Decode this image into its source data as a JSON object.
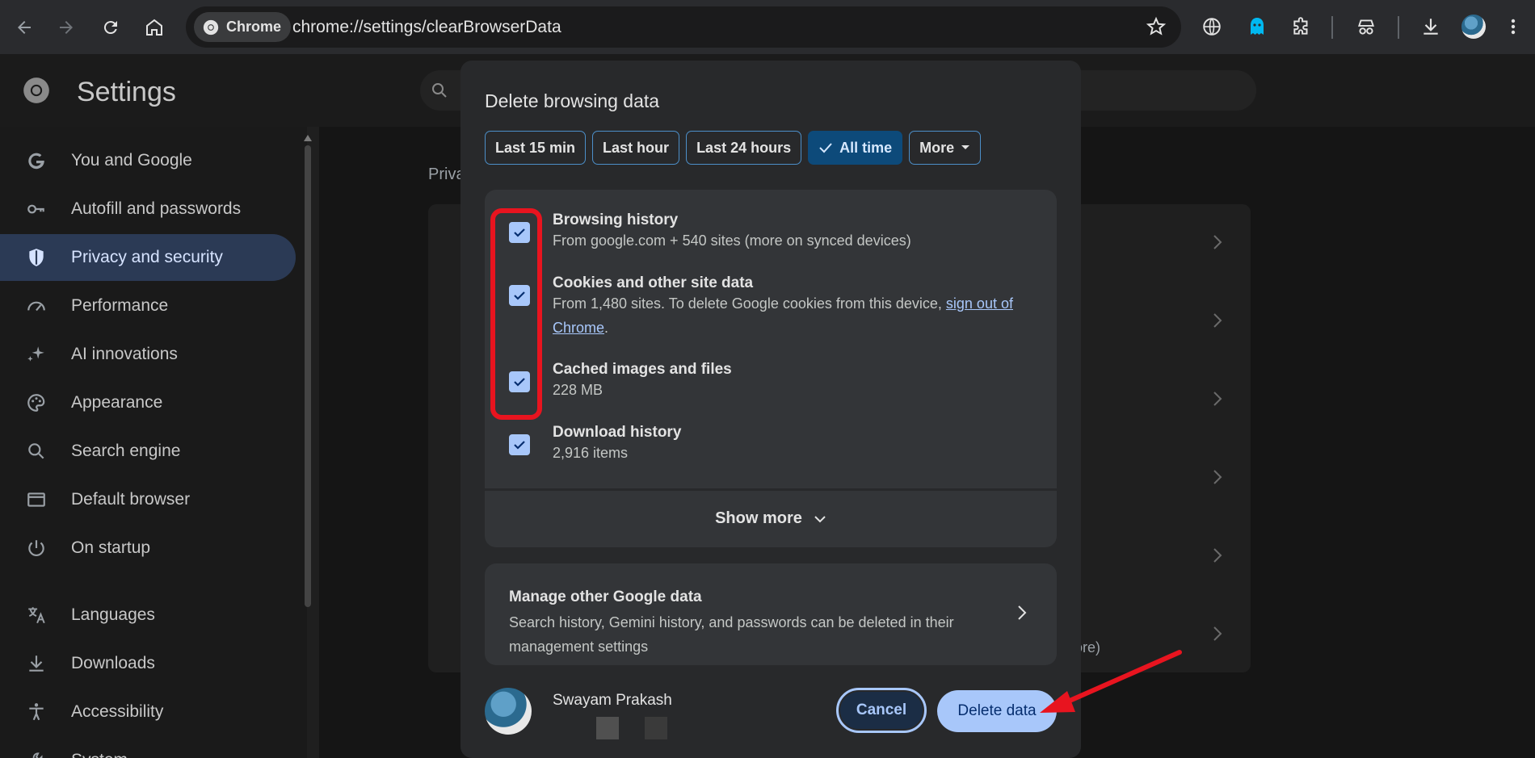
{
  "browser": {
    "chip_label": "Chrome",
    "url": "chrome://settings/clearBrowserData"
  },
  "settings": {
    "title": "Settings",
    "section_label": "Priva",
    "row_tail_text": "ore)",
    "sidebar": [
      {
        "label": "You and Google",
        "icon": "google-g-icon"
      },
      {
        "label": "Autofill and passwords",
        "icon": "key-icon"
      },
      {
        "label": "Privacy and security",
        "icon": "shield-icon",
        "active": true
      },
      {
        "label": "Performance",
        "icon": "speedometer-icon"
      },
      {
        "label": "AI innovations",
        "icon": "sparkle-icon"
      },
      {
        "label": "Appearance",
        "icon": "palette-icon"
      },
      {
        "label": "Search engine",
        "icon": "search-icon"
      },
      {
        "label": "Default browser",
        "icon": "browser-window-icon"
      },
      {
        "label": "On startup",
        "icon": "power-icon"
      },
      {
        "label": "Languages",
        "icon": "translate-icon"
      },
      {
        "label": "Downloads",
        "icon": "download-icon"
      },
      {
        "label": "Accessibility",
        "icon": "accessibility-icon"
      },
      {
        "label": "System",
        "icon": "wrench-icon"
      }
    ]
  },
  "dialog": {
    "title": "Delete browsing data",
    "time_ranges": [
      {
        "label": "Last 15 min",
        "selected": false
      },
      {
        "label": "Last hour",
        "selected": false
      },
      {
        "label": "Last 24 hours",
        "selected": false
      },
      {
        "label": "All time",
        "selected": true
      },
      {
        "label": "More",
        "selected": false
      }
    ],
    "items": [
      {
        "title": "Browsing history",
        "subtitle": "From google.com + 540 sites (more on synced devices)",
        "checked": true
      },
      {
        "title": "Cookies and other site data",
        "subtitle": "From 1,480 sites. To delete Google cookies from this device, ",
        "link": "sign out of Chrome",
        "suffix": ".",
        "checked": true
      },
      {
        "title": "Cached images and files",
        "subtitle": "228 MB",
        "checked": true
      },
      {
        "title": "Download history",
        "subtitle": "2,916 items",
        "checked": true
      }
    ],
    "show_more": "Show more",
    "manage": {
      "title": "Manage other Google data",
      "subtitle": "Search history, Gemini history, and passwords can be deleted in their management settings"
    },
    "account_name": "Swayam Prakash",
    "cancel_label": "Cancel",
    "delete_label": "Delete data"
  },
  "colors": {
    "accent": "#a8c7fa",
    "highlight": "#e8141f",
    "selected_chip": "#0d4a7a"
  }
}
